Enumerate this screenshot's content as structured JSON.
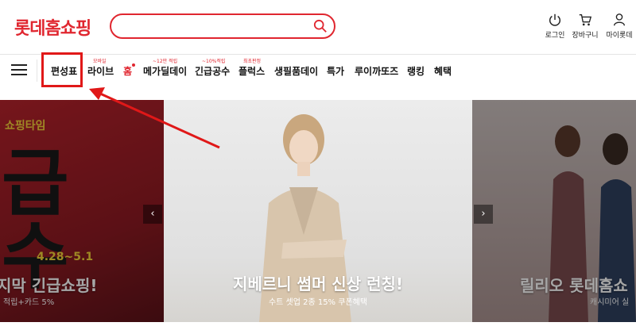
{
  "header": {
    "logo_text": "롯데홈쇼핑",
    "search": {
      "placeholder": "",
      "value": ""
    },
    "utility": [
      {
        "label": "로그인",
        "icon": "power-icon"
      },
      {
        "label": "장바구니",
        "icon": "cart-icon"
      },
      {
        "label": "마이롯데",
        "icon": "user-icon"
      }
    ]
  },
  "nav": {
    "items": [
      {
        "label": "편성표"
      },
      {
        "label": "라이브",
        "badge": "모바일"
      },
      {
        "label": "홈",
        "active": true
      },
      {
        "label": "메가딜데이",
        "badge": "~12만 적립"
      },
      {
        "label": "긴급공수",
        "badge": "~10%적립"
      },
      {
        "label": "플럭스",
        "badge": "최초판정"
      },
      {
        "label": "생필품데이"
      },
      {
        "label": "특가"
      },
      {
        "label": "루이까또즈"
      },
      {
        "label": "랭킹"
      },
      {
        "label": "혜택"
      }
    ]
  },
  "banner": {
    "left": {
      "badge": "쇼핑타임",
      "big_text": "급\n수",
      "date": "4.28~5.1",
      "title": "지막 긴급쇼핑!",
      "subtitle": "적립+카드 5%"
    },
    "center": {
      "title": "지베르니 썸머 신상 런칭!",
      "subtitle": "수트 셋업 2종 15% 쿠폰혜택"
    },
    "right": {
      "title": "릴리오 롯데홈쇼",
      "subtitle": "캐시미어 실"
    },
    "prev_arrow": "‹",
    "next_arrow": "›"
  },
  "colors": {
    "brand_red": "#e0262f",
    "annotation_red": "#e01818"
  }
}
